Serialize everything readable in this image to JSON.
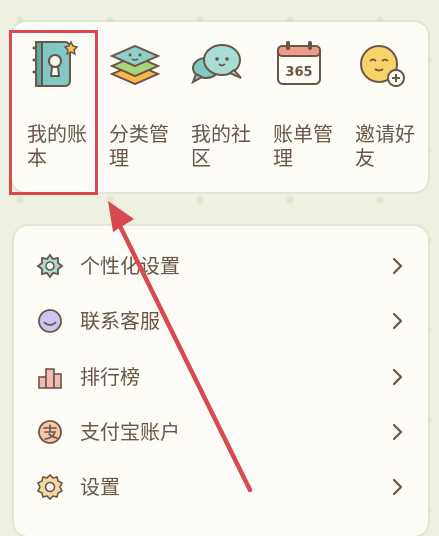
{
  "grid": {
    "items": [
      {
        "label": "我的账本",
        "icon": "account-book-icon"
      },
      {
        "label": "分类管理",
        "icon": "category-stack-icon"
      },
      {
        "label": "我的社区",
        "icon": "community-chat-icon"
      },
      {
        "label": "账单管理",
        "icon": "calendar-365-icon"
      },
      {
        "label": "邀请好友",
        "icon": "invite-friend-icon"
      }
    ],
    "calendar_text": "365"
  },
  "menu": {
    "items": [
      {
        "label": "个性化设置",
        "icon": "personalize-icon"
      },
      {
        "label": "联系客服",
        "icon": "customer-service-icon"
      },
      {
        "label": "排行榜",
        "icon": "leaderboard-icon"
      },
      {
        "label": "支付宝账户",
        "icon": "alipay-icon"
      },
      {
        "label": "设置",
        "icon": "settings-gear-icon"
      }
    ]
  },
  "colors": {
    "background": "#eef0e1",
    "card": "#fdfcf6",
    "text": "#6b5547",
    "annotation": "#d84a4f"
  }
}
